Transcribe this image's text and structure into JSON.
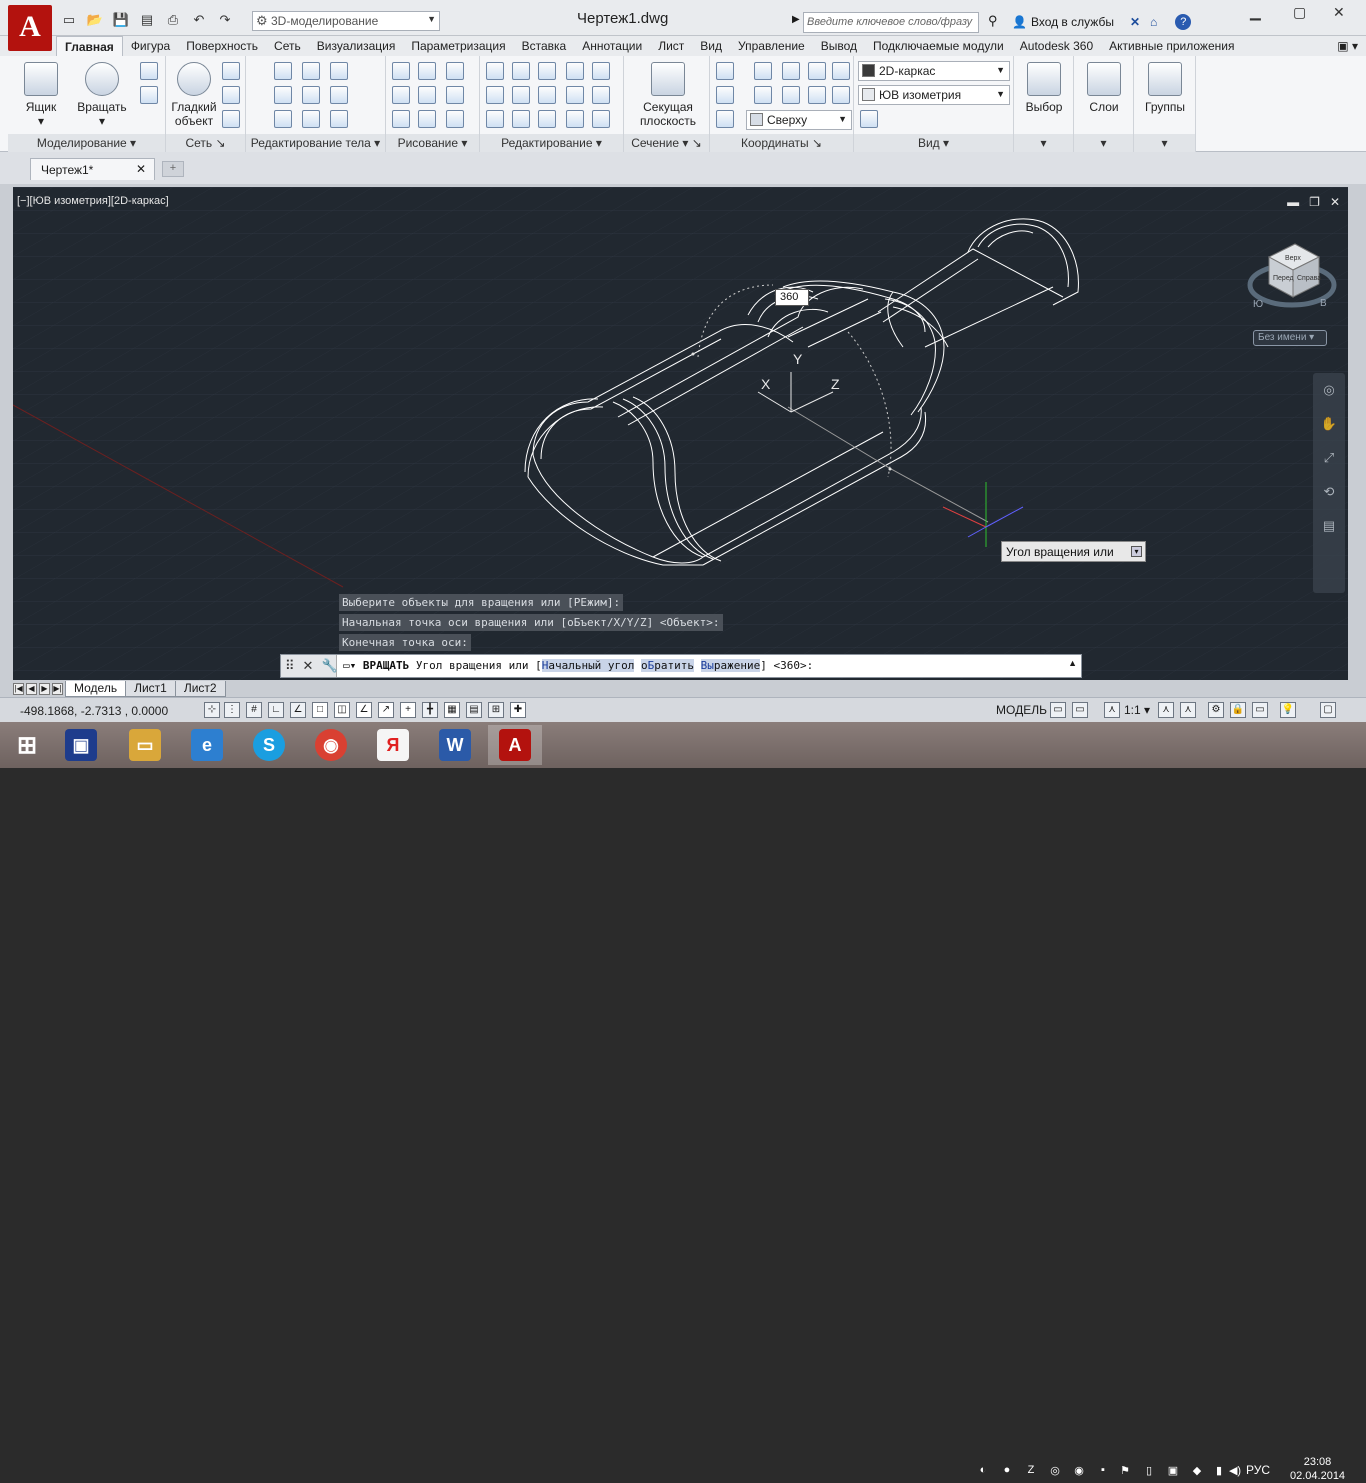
{
  "app": {
    "logo_letter": "A",
    "doc_title": "Чертеж1.dwg"
  },
  "workspace": {
    "value": "3D-моделирование"
  },
  "search": {
    "placeholder": "Введите ключевое слово/фразу"
  },
  "signin": {
    "label": "Вход в службы"
  },
  "ribbon_tabs": [
    "Главная",
    "Фигура",
    "Поверхность",
    "Сеть",
    "Визуализация",
    "Параметризация",
    "Вставка",
    "Аннотации",
    "Лист",
    "Вид",
    "Управление",
    "Вывод",
    "Подключаемые модули",
    "Autodesk 360",
    "Активные приложения"
  ],
  "panels": {
    "modeling": {
      "title": "Моделирование",
      "box": "Ящик",
      "revolve": "Вращать"
    },
    "mesh": {
      "title": "Сеть",
      "smooth": "Гладкий объект"
    },
    "solid_edit": {
      "title": "Редактирование тела"
    },
    "draw": {
      "title": "Рисование"
    },
    "modify": {
      "title": "Редактирование"
    },
    "section": {
      "title": "Сечение",
      "plane": "Секущая плоскость"
    },
    "coords": {
      "title": "Координаты"
    },
    "view": {
      "title": "Вид",
      "visual_style": "2D-каркас",
      "view_dir": "ЮВ изометрия",
      "ucs": "Сверху"
    },
    "select": {
      "label": "Выбор"
    },
    "layers": {
      "label": "Слои"
    },
    "groups": {
      "label": "Группы"
    }
  },
  "doc_tab": {
    "label": "Чертеж1*"
  },
  "viewport": {
    "label": "[−][ЮВ изометрия][2D-каркас]",
    "angle_input": "360",
    "tooltip": "Угол вращения или",
    "named_view": "Без имени",
    "viewcube": {
      "top": "Верх",
      "left": "Перед",
      "right": "Справа",
      "south": "Ю",
      "east": "В"
    }
  },
  "history": [
    "Выберите объекты для вращения или [РЕжим]:",
    "Начальная точка оси вращения или [оБъект/X/Y/Z] <Объект>:",
    "Конечная точка оси:"
  ],
  "command": {
    "name": "ВРАЩАТЬ",
    "prompt": "Угол вращения или [",
    "opt1_key": "Н",
    "opt1": "ачальный угол",
    "opt2_key": "о",
    "opt2a": "Б",
    "opt2": "ратить",
    "opt3_key": "Вы",
    "opt3": "ражение",
    "tail": "] <360>:"
  },
  "layout_tabs": [
    "Модель",
    "Лист1",
    "Лист2"
  ],
  "status": {
    "coords": "-498.1868, -2.7313 , 0.0000",
    "space": "МОДЕЛЬ",
    "scale": "1:1"
  },
  "taskbar": {
    "lang": "РУС",
    "time": "23:08",
    "date": "02.04.2014"
  }
}
